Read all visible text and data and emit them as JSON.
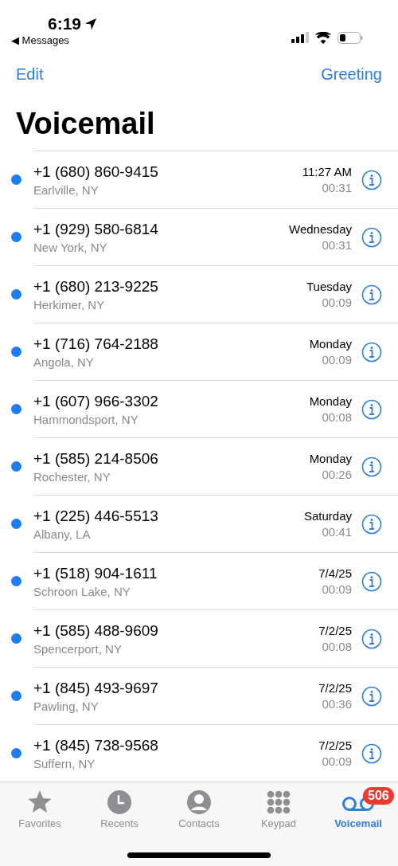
{
  "status_bar": {
    "time": "6:19",
    "back_app": "◀ Messages"
  },
  "nav": {
    "left": "Edit",
    "right": "Greeting"
  },
  "title": "Voicemail",
  "voicemails": [
    {
      "number": "+1 (680) 860-9415",
      "location": "Earlville, NY",
      "date": "11:27 AM",
      "duration": "00:31",
      "unread": true
    },
    {
      "number": "+1 (929) 580-6814",
      "location": "New York, NY",
      "date": "Wednesday",
      "duration": "00:31",
      "unread": true
    },
    {
      "number": "+1 (680) 213-9225",
      "location": "Herkimer, NY",
      "date": "Tuesday",
      "duration": "00:09",
      "unread": true
    },
    {
      "number": "+1 (716) 764-2188",
      "location": "Angola, NY",
      "date": "Monday",
      "duration": "00:09",
      "unread": true
    },
    {
      "number": "+1 (607) 966-3302",
      "location": "Hammondsport, NY",
      "date": "Monday",
      "duration": "00:08",
      "unread": true
    },
    {
      "number": "+1 (585) 214-8506",
      "location": "Rochester, NY",
      "date": "Monday",
      "duration": "00:26",
      "unread": true
    },
    {
      "number": "+1 (225) 446-5513",
      "location": "Albany, LA",
      "date": "Saturday",
      "duration": "00:41",
      "unread": true
    },
    {
      "number": "+1 (518) 904-1611",
      "location": "Schroon Lake, NY",
      "date": "7/4/25",
      "duration": "00:09",
      "unread": true
    },
    {
      "number": "+1 (585) 488-9609",
      "location": "Spencerport, NY",
      "date": "7/2/25",
      "duration": "00:08",
      "unread": true
    },
    {
      "number": "+1 (845) 493-9697",
      "location": "Pawling, NY",
      "date": "7/2/25",
      "duration": "00:36",
      "unread": true
    },
    {
      "number": "+1 (845) 738-9568",
      "location": "Suffern, NY",
      "date": "7/2/25",
      "duration": "00:09",
      "unread": true
    }
  ],
  "tab_bar": [
    {
      "kind": "favorites",
      "label": "Favorites",
      "selected": false
    },
    {
      "kind": "recents",
      "label": "Recents",
      "selected": false
    },
    {
      "kind": "contacts",
      "label": "Contacts",
      "selected": false
    },
    {
      "kind": "keypad",
      "label": "Keypad",
      "selected": false
    },
    {
      "kind": "voicemail",
      "label": "Voicemail",
      "selected": true,
      "badge": "506"
    }
  ]
}
